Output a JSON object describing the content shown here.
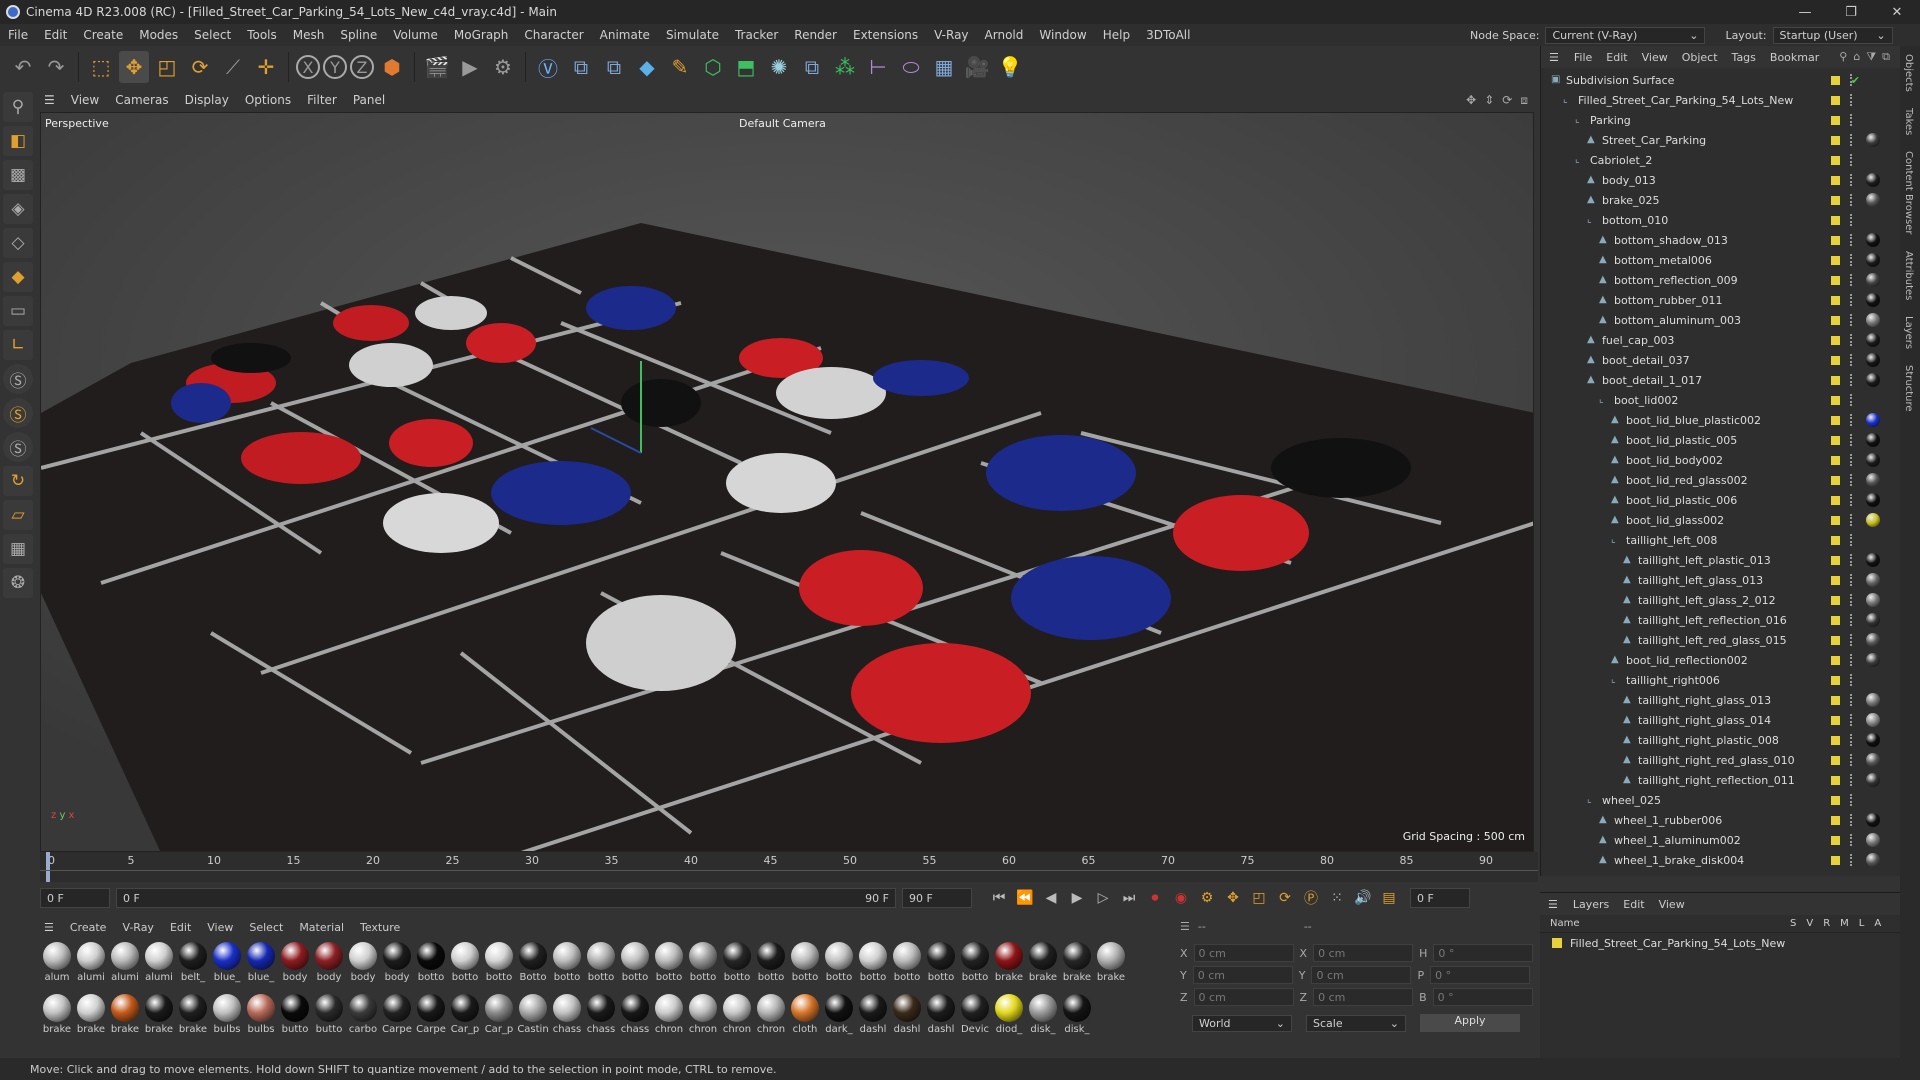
{
  "window": {
    "title": "Cinema 4D R23.008 (RC) - [Filled_Street_Car_Parking_54_Lots_New_c4d_vray.c4d] - Main"
  },
  "menu": [
    "File",
    "Edit",
    "Create",
    "Modes",
    "Select",
    "Tools",
    "Mesh",
    "Spline",
    "Volume",
    "MoGraph",
    "Character",
    "Animate",
    "Simulate",
    "Tracker",
    "Render",
    "Extensions",
    "V-Ray",
    "Arnold",
    "Window",
    "Help",
    "3DToAll"
  ],
  "nodespace": {
    "label": "Node Space:",
    "value": "Current (V-Ray)",
    "layout_label": "Layout:",
    "layout_value": "Startup (User)"
  },
  "viewport": {
    "menu": [
      "View",
      "Cameras",
      "Display",
      "Options",
      "Filter",
      "Panel"
    ],
    "name": "Perspective",
    "camera": "Default Camera",
    "grid_spacing": "Grid Spacing : 500 cm"
  },
  "timeline": {
    "ticks": [
      "0",
      "5",
      "10",
      "15",
      "20",
      "25",
      "30",
      "35",
      "40",
      "45",
      "50",
      "55",
      "60",
      "65",
      "70",
      "75",
      "80",
      "85",
      "90"
    ],
    "current_frame": "0 F",
    "start_frame": "0 F",
    "min_frame": "0 F",
    "end_frame": "90 F",
    "max_frame": "90 F"
  },
  "material_menu": [
    "Create",
    "V-Ray",
    "Edit",
    "View",
    "Select",
    "Material",
    "Texture"
  ],
  "materials": [
    {
      "n": "alum",
      "c": "#bdbdbd"
    },
    {
      "n": "alumi",
      "c": "#cfcfcf"
    },
    {
      "n": "alumi",
      "c": "#bababa"
    },
    {
      "n": "alumi",
      "c": "#d0d0d0"
    },
    {
      "n": "belt_",
      "c": "#1e1e1e"
    },
    {
      "n": "blue_",
      "c": "#1a2fc8"
    },
    {
      "n": "blue_",
      "c": "#1528b0"
    },
    {
      "n": "body",
      "c": "#8c1c20"
    },
    {
      "n": "body",
      "c": "#8a2024"
    },
    {
      "n": "body",
      "c": "#cfcfcf"
    },
    {
      "n": "body",
      "c": "#1c1c1c"
    },
    {
      "n": "botto",
      "c": "#0a0a0a"
    },
    {
      "n": "botto",
      "c": "#cfcfcf"
    },
    {
      "n": "botto",
      "c": "#d5d5d5"
    },
    {
      "n": "Botto",
      "c": "#202020"
    },
    {
      "n": "botto",
      "c": "#bdbdbd"
    },
    {
      "n": "botto",
      "c": "#b0b0b0"
    },
    {
      "n": "botto",
      "c": "#c0c0c0"
    },
    {
      "n": "botto",
      "c": "#bdbdbd"
    },
    {
      "n": "botto",
      "c": "#9a9a9a"
    },
    {
      "n": "botto",
      "c": "#262626"
    },
    {
      "n": "botto",
      "c": "#1c1c1c"
    },
    {
      "n": "botto",
      "c": "#bbbbbb"
    },
    {
      "n": "botto",
      "c": "#c2c2c2"
    },
    {
      "n": "botto",
      "c": "#d0d0d0"
    },
    {
      "n": "botto",
      "c": "#bcbcbc"
    },
    {
      "n": "botto",
      "c": "#1f1f1f"
    },
    {
      "n": "botto",
      "c": "#222222"
    },
    {
      "n": "brake",
      "c": "#8e1417"
    },
    {
      "n": "brake",
      "c": "#202020"
    },
    {
      "n": "brake",
      "c": "#262626"
    },
    {
      "n": "brake",
      "c": "#b0b0b0"
    },
    {
      "n": "brake",
      "c": "#c2c2c2"
    },
    {
      "n": "brake",
      "c": "#d0d0d0"
    },
    {
      "n": "brake",
      "c": "#c45a1a"
    },
    {
      "n": "brake",
      "c": "#1a1a1a"
    },
    {
      "n": "brake",
      "c": "#1f1f1f"
    },
    {
      "n": "bulbs",
      "c": "#c0c0c0"
    },
    {
      "n": "bulbs",
      "c": "#b86a5a"
    },
    {
      "n": "butto",
      "c": "#0a0a0a"
    },
    {
      "n": "butto",
      "c": "#2a2a2a"
    },
    {
      "n": "carbo",
      "c": "#3a3a3a"
    },
    {
      "n": "Carpe",
      "c": "#222222"
    },
    {
      "n": "Carpe",
      "c": "#181818"
    },
    {
      "n": "Car_p",
      "c": "#1a1a1a"
    },
    {
      "n": "Car_p",
      "c": "#8a8a8a"
    },
    {
      "n": "Castin",
      "c": "#a8a8a8"
    },
    {
      "n": "chass",
      "c": "#c2c2c2"
    },
    {
      "n": "chass",
      "c": "#1a1a1a"
    },
    {
      "n": "chass",
      "c": "#181818"
    },
    {
      "n": "chron",
      "c": "#cccccc"
    },
    {
      "n": "chron",
      "c": "#bdbdbd"
    },
    {
      "n": "chron",
      "c": "#c8c8c8"
    },
    {
      "n": "chron",
      "c": "#b5b5b5"
    },
    {
      "n": "cloth",
      "c": "#d7762a"
    },
    {
      "n": "dark_",
      "c": "#111111"
    },
    {
      "n": "dashl",
      "c": "#1a1a1a"
    },
    {
      "n": "dashl",
      "c": "#3a2a1a"
    },
    {
      "n": "dashl",
      "c": "#1c1c1c"
    },
    {
      "n": "Devic",
      "c": "#202020"
    },
    {
      "n": "diod_",
      "c": "#e2d81c"
    },
    {
      "n": "disk_",
      "c": "#9a9a9a"
    },
    {
      "n": "disk_",
      "c": "#151515"
    }
  ],
  "coords": {
    "x": "0 cm",
    "y": "0 cm",
    "z": "0 cm",
    "sx": "0 cm",
    "sy": "0 cm",
    "sz": "0 cm",
    "h": "0 °",
    "p": "0 °",
    "b": "0 °",
    "dash1": "--",
    "dash2": "--",
    "space": "World",
    "mode": "Scale",
    "apply": "Apply"
  },
  "status": "Move: Click and drag to move elements. Hold down SHIFT to quantize movement / add to the selection in point mode, CTRL to remove.",
  "objects_menu": [
    "File",
    "Edit",
    "View",
    "Object",
    "Tags",
    "Bookmar"
  ],
  "objects": [
    {
      "name": "Subdivision Surface",
      "d": 0,
      "icon": "▣",
      "ball": ""
    },
    {
      "name": "Filled_Street_Car_Parking_54_Lots_New",
      "d": 1,
      "icon": "⌞",
      "ball": ""
    },
    {
      "name": "Parking",
      "d": 2,
      "icon": "⌞",
      "ball": ""
    },
    {
      "name": "Street_Car_Parking",
      "d": 3,
      "icon": "▲",
      "ball": "#3a3a3a"
    },
    {
      "name": "Cabriolet_2",
      "d": 2,
      "icon": "⌞",
      "ball": ""
    },
    {
      "name": "body_013",
      "d": 3,
      "icon": "▲",
      "ball": "#1c1c1c"
    },
    {
      "name": "brake_025",
      "d": 3,
      "icon": "▲",
      "ball": "#555555"
    },
    {
      "name": "bottom_010",
      "d": 3,
      "icon": "⌞",
      "ball": ""
    },
    {
      "name": "bottom_shadow_013",
      "d": 4,
      "icon": "▲",
      "ball": "#111111"
    },
    {
      "name": "bottom_metal006",
      "d": 4,
      "icon": "▲",
      "ball": "#1a1a1a"
    },
    {
      "name": "bottom_reflection_009",
      "d": 4,
      "icon": "▲",
      "ball": "#444444"
    },
    {
      "name": "bottom_rubber_011",
      "d": 4,
      "icon": "▲",
      "ball": "#111111"
    },
    {
      "name": "bottom_aluminum_003",
      "d": 4,
      "icon": "▲",
      "ball": "#777777"
    },
    {
      "name": "fuel_cap_003",
      "d": 3,
      "icon": "▲",
      "ball": "#1a1a1a"
    },
    {
      "name": "boot_detail_037",
      "d": 3,
      "icon": "▲",
      "ball": "#151515"
    },
    {
      "name": "boot_detail_1_017",
      "d": 3,
      "icon": "▲",
      "ball": "#1a1a1a"
    },
    {
      "name": "boot_lid002",
      "d": 4,
      "icon": "⌞",
      "ball": ""
    },
    {
      "name": "boot_lid_blue_plastic002",
      "d": 5,
      "icon": "▲",
      "ball": "#1a2fc8"
    },
    {
      "name": "boot_lid_plastic_005",
      "d": 5,
      "icon": "▲",
      "ball": "#111111"
    },
    {
      "name": "boot_lid_body002",
      "d": 5,
      "icon": "▲",
      "ball": "#1c1c1c"
    },
    {
      "name": "boot_lid_red_glass002",
      "d": 5,
      "icon": "▲",
      "ball": "#555555"
    },
    {
      "name": "boot_lid_plastic_006",
      "d": 5,
      "icon": "▲",
      "ball": "#0f0f0f"
    },
    {
      "name": "boot_lid_glass002",
      "d": 5,
      "icon": "▲",
      "ball": "#c8c020"
    },
    {
      "name": "taillight_left_008",
      "d": 5,
      "icon": "⌞",
      "ball": ""
    },
    {
      "name": "taillight_left_plastic_013",
      "d": 6,
      "icon": "▲",
      "ball": "#111111"
    },
    {
      "name": "taillight_left_glass_013",
      "d": 6,
      "icon": "▲",
      "ball": "#666666"
    },
    {
      "name": "taillight_left_glass_2_012",
      "d": 6,
      "icon": "▲",
      "ball": "#777777"
    },
    {
      "name": "taillight_left_reflection_016",
      "d": 6,
      "icon": "▲",
      "ball": "#333333"
    },
    {
      "name": "taillight_left_red_glass_015",
      "d": 6,
      "icon": "▲",
      "ball": "#555555"
    },
    {
      "name": "boot_lid_reflection002",
      "d": 5,
      "icon": "▲",
      "ball": "#3a3a3a"
    },
    {
      "name": "taillight_right006",
      "d": 5,
      "icon": "⌞",
      "ball": ""
    },
    {
      "name": "taillight_right_glass_013",
      "d": 6,
      "icon": "▲",
      "ball": "#777777"
    },
    {
      "name": "taillight_right_glass_014",
      "d": 6,
      "icon": "▲",
      "ball": "#888888"
    },
    {
      "name": "taillight_right_plastic_008",
      "d": 6,
      "icon": "▲",
      "ball": "#0f0f0f"
    },
    {
      "name": "taillight_right_red_glass_010",
      "d": 6,
      "icon": "▲",
      "ball": "#555555"
    },
    {
      "name": "taillight_right_reflection_011",
      "d": 6,
      "icon": "▲",
      "ball": "#333333"
    },
    {
      "name": "wheel_025",
      "d": 3,
      "icon": "⌞",
      "ball": ""
    },
    {
      "name": "wheel_1_rubber006",
      "d": 4,
      "icon": "▲",
      "ball": "#111111"
    },
    {
      "name": "wheel_1_aluminum002",
      "d": 4,
      "icon": "▲",
      "ball": "#777777"
    },
    {
      "name": "wheel_1_brake_disk004",
      "d": 4,
      "icon": "▲",
      "ball": "#555555"
    }
  ],
  "layers_menu": [
    "Layers",
    "Edit",
    "View"
  ],
  "layers": {
    "name_col": "Name",
    "cols": [
      "S",
      "V",
      "R",
      "M",
      "L",
      "A"
    ],
    "item": "Filled_Street_Car_Parking_54_Lots_New"
  },
  "side_tabs": [
    "Objects",
    "Takes",
    "Content Browser",
    "Attributes",
    "Layers",
    "Structure"
  ]
}
